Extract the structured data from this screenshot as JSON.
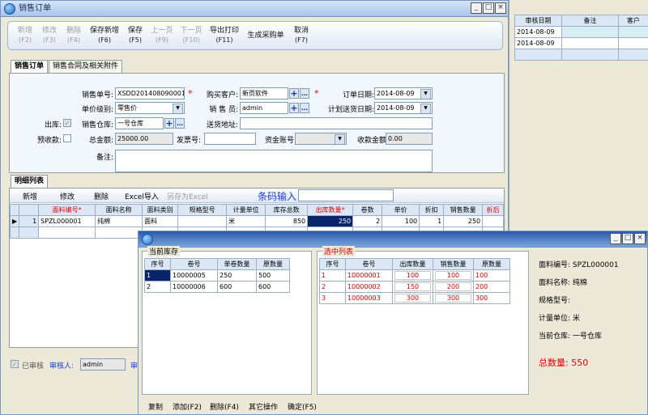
{
  "main_window": {
    "title": "销售订单"
  },
  "toolbar": [
    {
      "label": "新增",
      "key": "(F2)",
      "disabled": true
    },
    {
      "label": "修改",
      "key": "(F3)",
      "disabled": true
    },
    {
      "label": "删除",
      "key": "(F4)",
      "disabled": true
    },
    {
      "label": "保存新增",
      "key": "(F6)",
      "disabled": false
    },
    {
      "label": "保存",
      "key": "(F5)",
      "disabled": false
    },
    {
      "label": "上一页",
      "key": "(F9)",
      "disabled": true
    },
    {
      "label": "下一页",
      "key": "(F10)",
      "disabled": true
    },
    {
      "label": "导出打印",
      "key": "(F11)",
      "disabled": false
    },
    {
      "label": "生成采购单",
      "key": "",
      "disabled": false
    },
    {
      "label": "取消",
      "key": "(F7)",
      "disabled": false
    }
  ],
  "tabs": [
    "销售订单",
    "销售合同及相关附件"
  ],
  "form": {
    "order_no_label": "销售单号:",
    "order_no": "XSDD201408090001",
    "customer_label": "购买客户:",
    "customer": "新页软件",
    "order_date_label": "订单日期:",
    "order_date": "2014-08-09",
    "price_level_label": "单价级别:",
    "price_level": "零售价",
    "salesman_label": "销 售 员:",
    "salesman": "admin",
    "plan_date_label": "计划送货日期:",
    "plan_date": "2014-08-09",
    "outbound_label": "出库:",
    "warehouse_label": "销售仓库:",
    "warehouse": "一号仓库",
    "address_label": "送货地址:",
    "prepay_label": "预收款:",
    "total_label": "总金额:",
    "total": "25000.00",
    "invoice_label": "发票号:",
    "account_label": "资金账号:",
    "received_label": "收款金额:",
    "received": "0.00",
    "remark_label": "备注:"
  },
  "detail": {
    "tab": "明细列表",
    "buttons": [
      "新增",
      "修改",
      "删除",
      "Excel导入",
      "另存为Excel"
    ],
    "barcode_label": "条码输入",
    "columns": [
      "面料编号*",
      "面料名称",
      "面料类别",
      "规格型号",
      "计量单位",
      "库存总数",
      "出库数量*",
      "卷数",
      "单价",
      "折扣",
      "销售数量",
      "折后"
    ],
    "rows": [
      {
        "idx": "1",
        "code": "SPZL000001",
        "name": "纯棉",
        "category": "面料",
        "spec": "",
        "unit": "米",
        "stock": "850",
        "out_qty": "250",
        "rolls": "2",
        "price": "100",
        "discount": "1",
        "sale_qty": "250"
      }
    ]
  },
  "footer": {
    "audited_label": "已审核",
    "auditor_label": "审核人:",
    "auditor": "admin",
    "auditor2_label": "审"
  },
  "right_panel": {
    "columns": [
      "审核日期",
      "备注",
      "客户"
    ],
    "rows": [
      [
        "2014-08-09",
        "",
        ""
      ],
      [
        "2014-08-09",
        "",
        ""
      ]
    ]
  },
  "dialog": {
    "current_stock_title": "当前库存",
    "stock_columns": [
      "序号",
      "卷号",
      "单卷数量",
      "原数量"
    ],
    "stock_rows": [
      [
        "1",
        "10000005",
        "250",
        "500"
      ],
      [
        "2",
        "10000006",
        "600",
        "600"
      ]
    ],
    "selected_title": "选中列表",
    "selected_columns": [
      "序号",
      "卷号",
      "出库数量",
      "销售数量",
      "原数量"
    ],
    "selected_rows": [
      [
        "1",
        "10000001",
        "100",
        "100",
        "100"
      ],
      [
        "2",
        "10000002",
        "150",
        "200",
        "200"
      ],
      [
        "3",
        "10000003",
        "300",
        "300",
        "300"
      ]
    ],
    "info": {
      "code_label": "面料编号:",
      "code": "SPZL000001",
      "name_label": "面料名称:",
      "name": "纯棉",
      "spec_label": "规格型号:",
      "unit_label": "计量单位:",
      "unit": "米",
      "warehouse_label": "当前仓库:",
      "warehouse": "一号仓库",
      "total_label": "总数量:",
      "total": "550"
    },
    "buttons": [
      "复制",
      "添加(F2)",
      "删除(F4)",
      "其它操作",
      "确定(F5)"
    ]
  },
  "colors": {
    "accent": "#0a246a",
    "required": "#e60000",
    "title_bar": "#a9c4ea"
  }
}
